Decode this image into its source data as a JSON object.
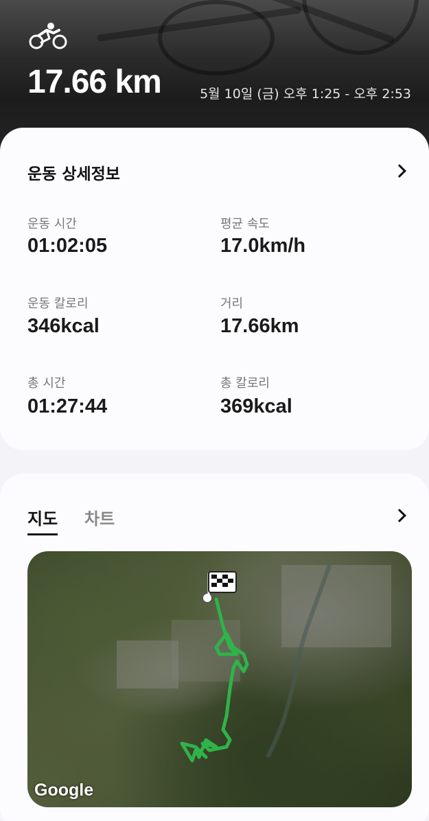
{
  "header": {
    "distance": "17.66 km",
    "datetime": "5월 10일 (금) 오후 1:25 - 오후 2:53"
  },
  "details": {
    "title": "운동 상세정보",
    "stats": [
      {
        "label": "운동 시간",
        "value": "01:02:05"
      },
      {
        "label": "평균 속도",
        "value": "17.0km/h"
      },
      {
        "label": "운동 칼로리",
        "value": "346kcal"
      },
      {
        "label": "거리",
        "value": "17.66km"
      },
      {
        "label": "총 시간",
        "value": "01:27:44"
      },
      {
        "label": "총 칼로리",
        "value": "369kcal"
      }
    ]
  },
  "map_card": {
    "tabs": [
      {
        "label": "지도",
        "active": true
      },
      {
        "label": "차트",
        "active": false
      }
    ],
    "map_attribution": "Google",
    "route_color": "#2fb34a"
  }
}
